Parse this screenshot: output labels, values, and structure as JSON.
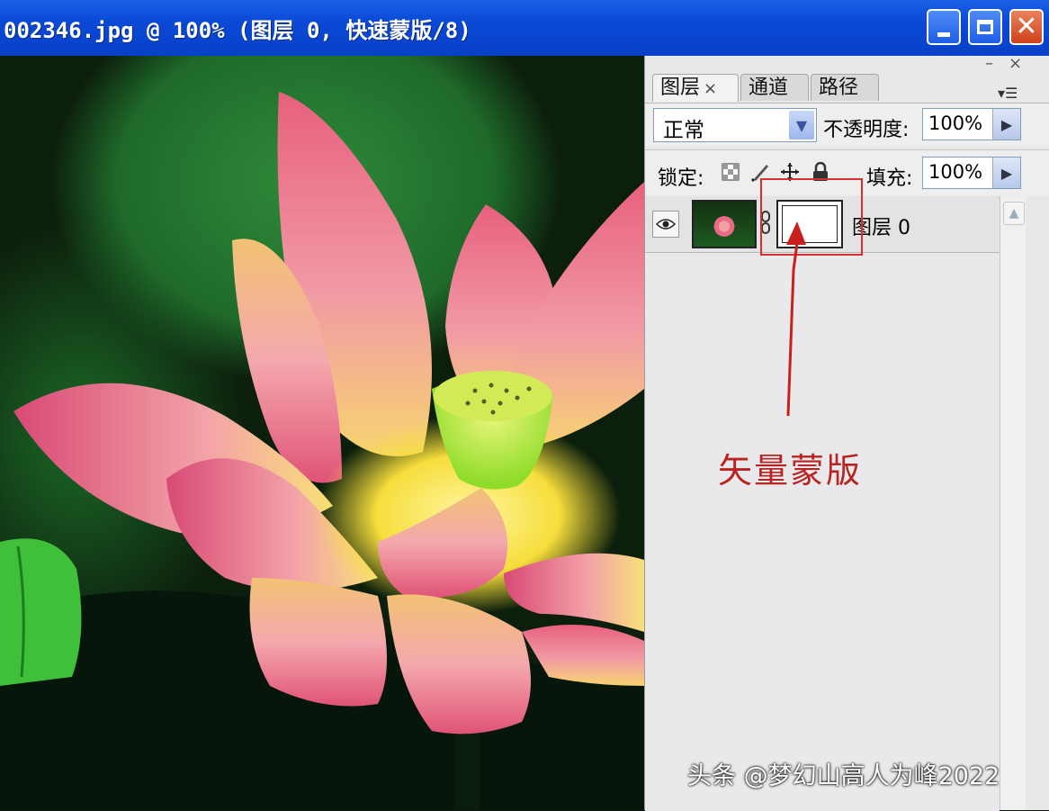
{
  "window": {
    "title": "002346.jpg @ 100% (图层 0, 快速蒙版/8)",
    "minimize_icon": "minimize-icon",
    "maximize_icon": "maximize-icon",
    "close_glyph": "✕",
    "colors": {
      "titlebar": "#0a49d6",
      "close": "#d0411b"
    }
  },
  "panel": {
    "collapse_glyph": "–",
    "close_glyph": "×",
    "tabs": [
      {
        "label": "图层",
        "active": true
      },
      {
        "label": "通道",
        "active": false
      },
      {
        "label": "路径",
        "active": false
      }
    ],
    "tab_close_glyph": "×",
    "menu_glyph": "▾☰",
    "blend_mode": "正常",
    "opacity_label": "不透明度:",
    "opacity_value": "100%",
    "lock_label": "锁定:",
    "fill_label": "填充:",
    "fill_value": "100%",
    "lock_icons": [
      "lock-transparent-icon",
      "lock-brush-icon",
      "lock-move-icon",
      "lock-all-icon"
    ],
    "layers": [
      {
        "name": "图层 0",
        "visible": true,
        "has_vector_mask": true
      }
    ]
  },
  "annotation": {
    "label": "矢量蒙版",
    "color": "#d9302c"
  },
  "watermark": "头条 @梦幻山高人为峰2022"
}
